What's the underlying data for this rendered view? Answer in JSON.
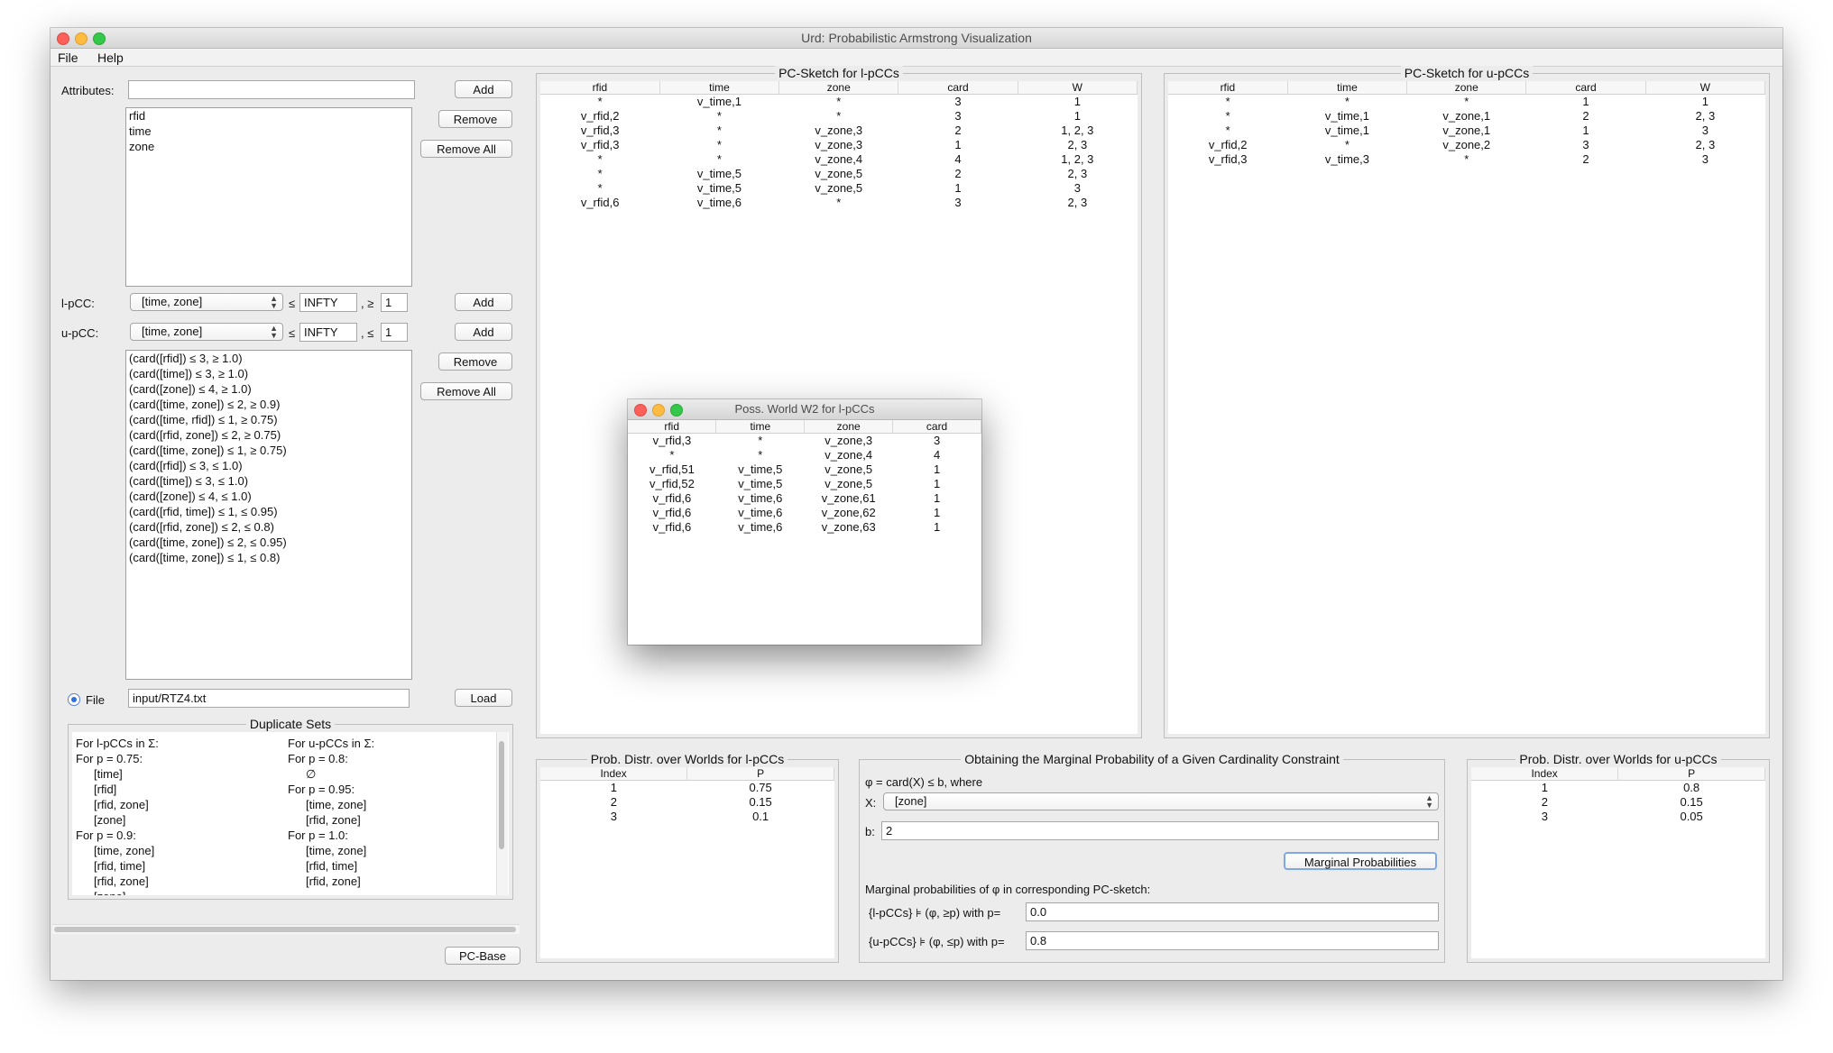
{
  "window": {
    "title": "Urd: Probabilistic Armstrong Visualization"
  },
  "menu": {
    "file": "File",
    "help": "Help"
  },
  "left": {
    "attributes_label": "Attributes:",
    "attributes_value": "",
    "add_label": "Add",
    "remove_label": "Remove",
    "remove_all_label": "Remove All",
    "attribute_items": [
      "rfid",
      "time",
      "zone"
    ],
    "lpcc_label": "l-pCC:",
    "lpcc_combo": "[time, zone]",
    "lpcc_le": "≤",
    "lpcc_bound": "INFTY",
    "lpcc_sep": ", ≥",
    "lpcc_prob": "1",
    "upcc_label": "u-pCC:",
    "upcc_combo": "[time, zone]",
    "upcc_le": "≤",
    "upcc_bound": "INFTY",
    "upcc_sep": ", ≤",
    "upcc_prob": "1",
    "constraints": [
      "(card([rfid]) ≤ 3,  ≥ 1.0)",
      "(card([time]) ≤ 3,  ≥ 1.0)",
      "(card([zone]) ≤ 4,  ≥ 1.0)",
      "(card([time, zone]) ≤ 2,  ≥ 0.9)",
      "(card([time, rfid]) ≤ 1,  ≥ 0.75)",
      "(card([rfid, zone]) ≤ 2,  ≥ 0.75)",
      "(card([time, zone]) ≤ 1,  ≥ 0.75)",
      "(card([rfid]) ≤ 3,  ≤ 1.0)",
      "(card([time]) ≤ 3,  ≤ 1.0)",
      "(card([zone]) ≤ 4,  ≤ 1.0)",
      "(card([rfid, time]) ≤ 1,  ≤ 0.95)",
      "(card([rfid, zone]) ≤ 2,  ≤ 0.8)",
      "(card([time, zone]) ≤ 2,  ≤ 0.95)",
      "(card([time, zone]) ≤ 1,  ≤ 0.8)"
    ],
    "file_label": "File",
    "file_value": "input/RTZ4.txt",
    "load_label": "Load",
    "duplicate_title": "Duplicate Sets",
    "dup_left": [
      "For l-pCCs in Σ:",
      "For p = 0.75:",
      "[time]",
      "[rfid]",
      "[rfid, zone]",
      "[zone]",
      "For p = 0.9:",
      "[time, zone]",
      "[rfid, time]",
      "[rfid, zone]",
      "[zone]"
    ],
    "dup_right": [
      "For u-pCCs in Σ:",
      "For p = 0.8:",
      "∅",
      "For p = 0.95:",
      "[time, zone]",
      "[rfid, zone]",
      "For p = 1.0:",
      "[time, zone]",
      "[rfid, time]",
      "[rfid, zone]"
    ],
    "pcbase_label": "PC-Base"
  },
  "sketch_l": {
    "title": "PC-Sketch for l-pCCs",
    "headers": [
      "rfid",
      "time",
      "zone",
      "card",
      "W"
    ],
    "rows": [
      [
        "*",
        "v_time,1",
        "*",
        "3",
        "1"
      ],
      [
        "v_rfid,2",
        "*",
        "*",
        "3",
        "1"
      ],
      [
        "v_rfid,3",
        "*",
        "v_zone,3",
        "2",
        "1, 2, 3"
      ],
      [
        "v_rfid,3",
        "*",
        "v_zone,3",
        "1",
        "2, 3"
      ],
      [
        "*",
        "*",
        "v_zone,4",
        "4",
        "1, 2, 3"
      ],
      [
        "*",
        "v_time,5",
        "v_zone,5",
        "2",
        "2, 3"
      ],
      [
        "*",
        "v_time,5",
        "v_zone,5",
        "1",
        "3"
      ],
      [
        "v_rfid,6",
        "v_time,6",
        "*",
        "3",
        "2, 3"
      ]
    ]
  },
  "sketch_u": {
    "title": "PC-Sketch for u-pCCs",
    "headers": [
      "rfid",
      "time",
      "zone",
      "card",
      "W"
    ],
    "rows": [
      [
        "*",
        "*",
        "*",
        "1",
        "1"
      ],
      [
        "*",
        "v_time,1",
        "v_zone,1",
        "2",
        "2, 3"
      ],
      [
        "*",
        "v_time,1",
        "v_zone,1",
        "1",
        "3"
      ],
      [
        "v_rfid,2",
        "*",
        "v_zone,2",
        "3",
        "2, 3"
      ],
      [
        "v_rfid,3",
        "v_time,3",
        "*",
        "2",
        "3"
      ]
    ]
  },
  "poss_world": {
    "title": "Poss. World W2 for l-pCCs",
    "headers": [
      "rfid",
      "time",
      "zone",
      "card"
    ],
    "rows": [
      [
        "v_rfid,3",
        "*",
        "v_zone,3",
        "3"
      ],
      [
        "*",
        "*",
        "v_zone,4",
        "4"
      ],
      [
        "v_rfid,51",
        "v_time,5",
        "v_zone,5",
        "1"
      ],
      [
        "v_rfid,52",
        "v_time,5",
        "v_zone,5",
        "1"
      ],
      [
        "v_rfid,6",
        "v_time,6",
        "v_zone,61",
        "1"
      ],
      [
        "v_rfid,6",
        "v_time,6",
        "v_zone,62",
        "1"
      ],
      [
        "v_rfid,6",
        "v_time,6",
        "v_zone,63",
        "1"
      ]
    ]
  },
  "prob_l": {
    "title": "Prob. Distr. over Worlds for l-pCCs",
    "headers": [
      "Index",
      "P"
    ],
    "rows": [
      [
        "1",
        "0.75"
      ],
      [
        "2",
        "0.15"
      ],
      [
        "3",
        "0.1"
      ]
    ]
  },
  "prob_u": {
    "title": "Prob. Distr. over Worlds for u-pCCs",
    "headers": [
      "Index",
      "P"
    ],
    "rows": [
      [
        "1",
        "0.8"
      ],
      [
        "2",
        "0.15"
      ],
      [
        "3",
        "0.05"
      ]
    ]
  },
  "marginal": {
    "title": "Obtaining the Marginal Probability of a Given Cardinality Constraint",
    "phi_text": "φ = card(X) ≤ b, where",
    "x_label": "X:",
    "x_value": "[zone]",
    "b_label": "b:",
    "b_value": "2",
    "button_label": "Marginal Probabilities",
    "result_text": "Marginal probabilities of φ in corresponding PC-sketch:",
    "l_label": "{l-pCCs} ⊧ (φ, ≥p)  with p=",
    "l_value": "0.0",
    "u_label": "{u-pCCs} ⊧ (φ, ≤p) with p=",
    "u_value": "0.8"
  }
}
